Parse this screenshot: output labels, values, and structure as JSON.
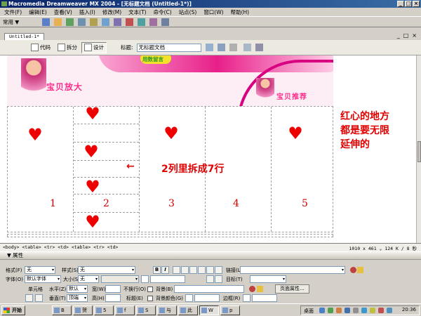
{
  "window": {
    "title": "Macromedia Dreamweaver MX 2004 - [无标题文档 (Untitled-1*)]",
    "minimize": "_",
    "maximize": "□",
    "close": "×"
  },
  "menu": [
    "文件(F)",
    "编辑(E)",
    "查看(V)",
    "插入(I)",
    "修改(M)",
    "文本(T)",
    "命令(C)",
    "站点(S)",
    "窗口(W)",
    "帮助(H)"
  ],
  "insertbar": {
    "category": "常用 ▼"
  },
  "document": {
    "tab": "Untitled-1*",
    "controls": [
      "_",
      "□",
      "×"
    ],
    "views": [
      {
        "label": "代码"
      },
      {
        "label": "拆分"
      },
      {
        "label": "设计"
      }
    ],
    "title_label": "标题:",
    "title_value": "无标题文档"
  },
  "banner": {
    "left_title": "宝贝放大",
    "right_title": "宝贝推荐",
    "top_label": "用数留言"
  },
  "table": {
    "heart": "♥",
    "col_numbers": [
      "1",
      "2",
      "3",
      "4",
      "5"
    ]
  },
  "annotations": {
    "split": "2列里拆成7行",
    "arrow": "←",
    "note": [
      "红心的地方",
      "都是要无限",
      "延伸的"
    ]
  },
  "status": {
    "tagpath": "<body> <table> <tr> <td> <table> <tr> <td>",
    "dims": "1010 x 461 ⌄ 124 K / 8 秒"
  },
  "properties": {
    "header": "▼ 属性",
    "format_label": "格式(F)",
    "format_value": "无",
    "style_label": "样式(S)",
    "style_value": "无",
    "bold": "B",
    "italic": "I",
    "link_label": "链接(L)",
    "font_label": "字体(O)",
    "font_value": "默认字体",
    "size_label": "大小(S)",
    "size_value": "无",
    "target_label": "目标(T)",
    "cell_label": "单元格",
    "horz_label": "水平(Z)",
    "horz_value": "默认",
    "width_label": "宽(W)",
    "nowrap_label": "不换行(O)",
    "bg_label": "背景(B)",
    "page_props_button": "页面属性...",
    "vert_label": "垂直(T)",
    "vert_value": "顶端",
    "height_label": "高(H)",
    "header_label": "标题(E)",
    "bgcolor_label": "背景颜色(G)",
    "border_label": "边框(R)"
  },
  "taskbar": {
    "start": "开始",
    "items": [
      "B",
      "贺",
      "5",
      "f",
      "S",
      "与",
      "此",
      "W",
      "p"
    ],
    "tray_label": "桌面",
    "clock": "20:36"
  },
  "colors": {
    "heart": "#ee0000",
    "annotation": "#e00000",
    "title_bar": "#0a246a"
  }
}
